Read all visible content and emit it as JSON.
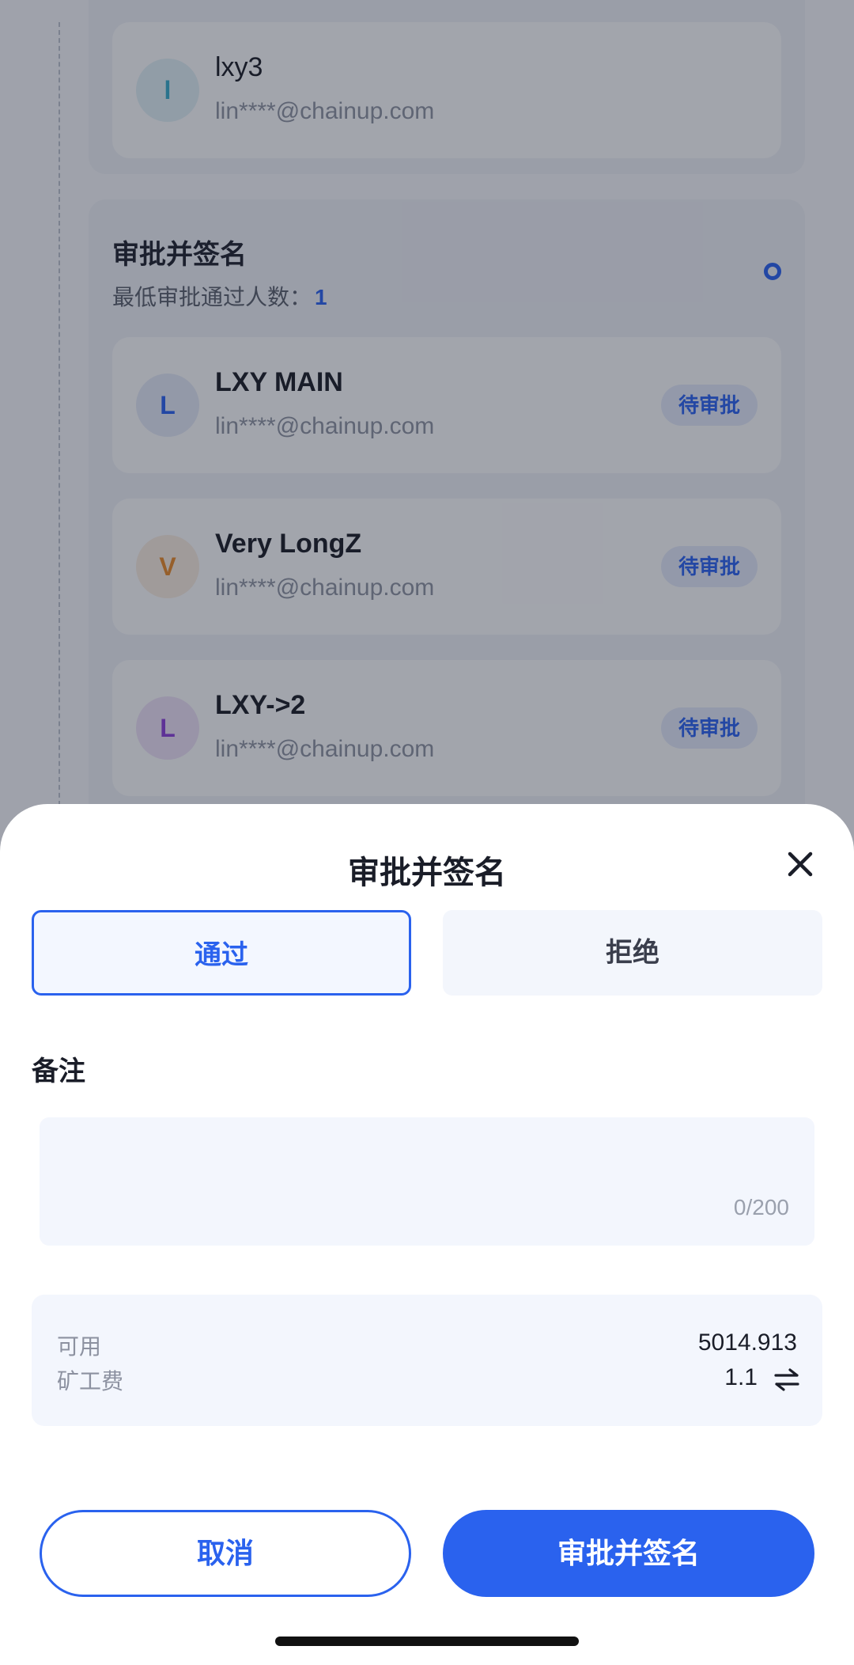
{
  "background": {
    "group1": {
      "members": [
        {
          "avatar": "l",
          "name": "lxy3",
          "email": "lin****@chainup.com",
          "avatar_color": "#36a9c9",
          "avatar_bg": "#dcecf2"
        }
      ]
    },
    "group2": {
      "title": "审批并签名",
      "min_label": "最低审批通过人数：",
      "min_value": "1",
      "members": [
        {
          "avatar": "L",
          "name": "LXY MAIN",
          "email": "lin****@chainup.com",
          "status": "待审批",
          "avatar_color": "#2a62ee",
          "avatar_bg": "#dfe5f4"
        },
        {
          "avatar": "V",
          "name": "Very LongZ",
          "email": "lin****@chainup.com",
          "status": "待审批",
          "avatar_color": "#e4882a",
          "avatar_bg": "#f4e8dd"
        },
        {
          "avatar": "L",
          "name": "LXY->2",
          "email": "lin****@chainup.com",
          "status": "待审批",
          "avatar_color": "#8a3fd9",
          "avatar_bg": "#e9def4"
        }
      ]
    }
  },
  "sheet": {
    "title": "审批并签名",
    "approve_label": "通过",
    "reject_label": "拒绝",
    "remark_label": "备注",
    "remark_placeholder": "",
    "remark_count": "0/200",
    "available_label": "可用",
    "available_value": "5014.913",
    "fee_label": "矿工费",
    "fee_value": "1.1",
    "cancel_label": "取消",
    "submit_label": "审批并签名"
  },
  "colors": {
    "accent": "#2a62ee",
    "overlay": "rgba(24,28,44,0.38)"
  }
}
